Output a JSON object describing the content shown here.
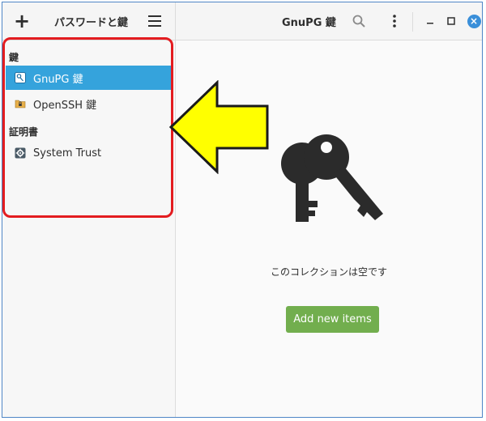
{
  "header": {
    "app_title": "パスワードと鍵",
    "view_title": "GnuPG 鍵",
    "add_icon": "plus-icon",
    "menu_icon": "hamburger-menu-icon",
    "search_icon": "search-icon",
    "more_icon": "more-vert-icon",
    "window_controls": [
      "minimize-icon",
      "maximize-icon",
      "close-icon"
    ]
  },
  "sidebar": {
    "sections": [
      {
        "header": "鍵",
        "items": [
          {
            "label": "GnuPG 鍵",
            "icon": "gnupg-keyring-icon",
            "selected": true
          },
          {
            "label": "OpenSSH 鍵",
            "icon": "folder-key-icon",
            "selected": false
          }
        ]
      },
      {
        "header": "証明書",
        "items": [
          {
            "label": "System Trust",
            "icon": "gear-icon",
            "selected": false
          }
        ]
      }
    ]
  },
  "main": {
    "empty_icon": "keys-icon",
    "empty_text": "このコレクションは空です",
    "add_button": "Add new items"
  },
  "colors": {
    "selection": "#35a3dc",
    "add_button": "#72ae4e",
    "annotation_red": "#e31c20",
    "annotation_arrow": "#ffff00"
  }
}
